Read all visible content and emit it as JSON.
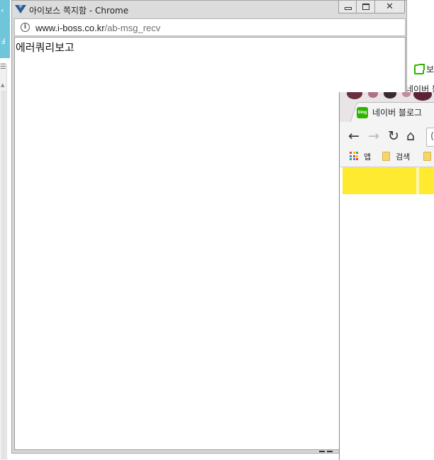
{
  "popup": {
    "window_title": "아이보스 쪽지함 - Chrome",
    "url_host": "www.i-boss.co.kr",
    "url_path": "/ab-msg_recv",
    "content_text": "에러쿼리보고",
    "controls": {
      "minimize_icon": "minimize-icon",
      "maximize_icon": "maximize-icon",
      "close_glyph": "✕"
    }
  },
  "background_window": {
    "tab_title": "네이버 블로그",
    "favicon_text": "blog",
    "toolbar": {
      "back_glyph": "←",
      "forward_glyph": "→",
      "reload_glyph": "↻",
      "home_glyph": "⌂",
      "omnibox_text": "(",
      "bookmarks": [
        {
          "label": "앱",
          "icon": "apps-grid-icon"
        },
        {
          "label": "검색",
          "icon": "folder-icon"
        }
      ]
    }
  },
  "background_page": {
    "left_glyphs": [
      "‹",
      "Ⅎ"
    ],
    "menu_glyph": "☰",
    "scroll_arrow": "▲",
    "share_label": "보",
    "naver_label": "네이버 블"
  },
  "colors": {
    "chrome_frame": "#d6d6d6",
    "teal_sidebar": "#6fc5d9",
    "naver_green": "#2db400",
    "banner_yellow": "#ffea32"
  }
}
